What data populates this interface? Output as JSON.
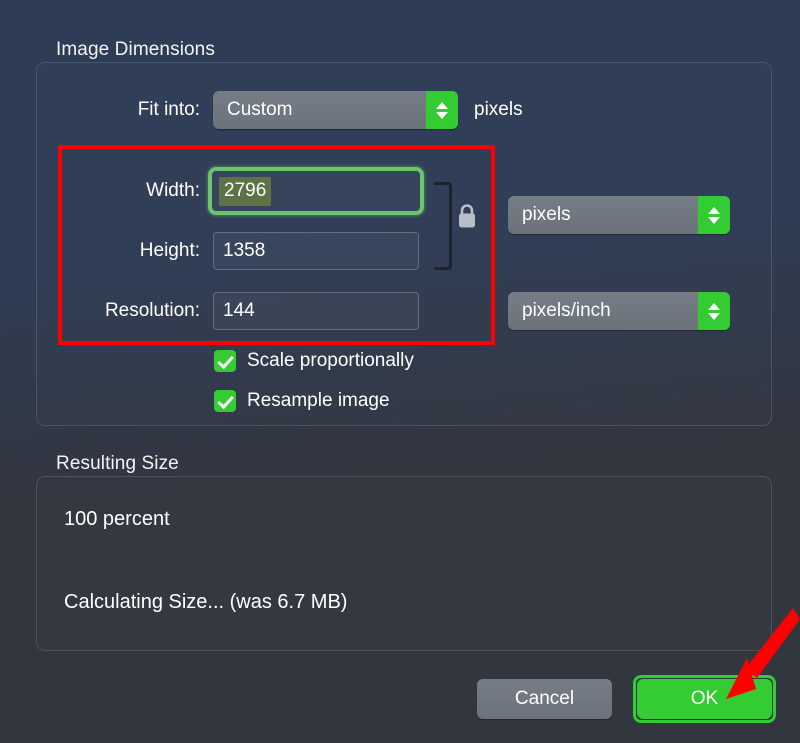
{
  "dialog": {
    "sections": {
      "image_dimensions": {
        "heading": "Image Dimensions"
      },
      "resulting_size": {
        "heading": "Resulting Size"
      }
    },
    "fit_into": {
      "label": "Fit into:",
      "selected": "Custom",
      "unit_suffix": "pixels"
    },
    "width": {
      "label": "Width:",
      "value": "2796",
      "focused": true,
      "selected_text": true
    },
    "height": {
      "label": "Height:",
      "value": "1358"
    },
    "resolution": {
      "label": "Resolution:",
      "value": "144"
    },
    "dimension_units": {
      "selected": "pixels"
    },
    "resolution_units": {
      "selected": "pixels/inch"
    },
    "link_lock": {
      "icon": "lock-closed-icon",
      "state": "locked"
    },
    "checkboxes": [
      {
        "label": "Scale proportionally",
        "checked": true
      },
      {
        "label": "Resample image",
        "checked": true
      }
    ],
    "resulting_size": {
      "percent_line": "100 percent",
      "size_line": "Calculating Size... (was 6.7 MB)"
    },
    "buttons": {
      "cancel": "Cancel",
      "ok": "OK"
    }
  },
  "annotations": {
    "highlight_rect": {
      "color": "#ff0000"
    },
    "arrow": {
      "color": "#ff0000",
      "points_to": "OK"
    },
    "ok_highlight": {
      "color": "#33cc33"
    },
    "width_focus_ring": {
      "color": "#6cc46c"
    }
  },
  "colors": {
    "accent_green": "#33cc33",
    "annotation_red": "#ff0000",
    "selection_olive": "#5c7348",
    "panel_blue": "#2e3c56",
    "panel_gray": "#32363f"
  }
}
